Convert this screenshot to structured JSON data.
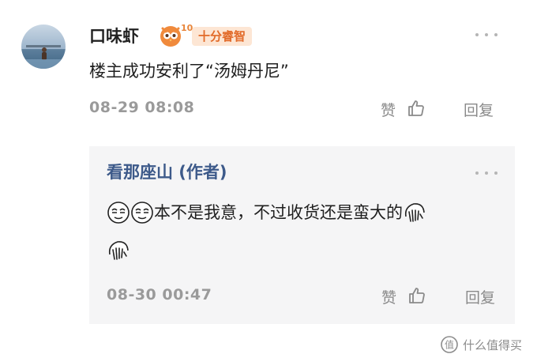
{
  "comment": {
    "username": "口味虾",
    "badge": {
      "level": "10",
      "label": "十分睿智"
    },
    "text": "楼主成功安利了“汤姆丹尼”",
    "timestamp": "08-29 08:08",
    "like_label": "赞",
    "reply_label": "回复"
  },
  "reply": {
    "author": "看那座山 (作者)",
    "text": "本不是我意，不过收货还是蛮大的",
    "timestamp": "08-30 00:47",
    "like_label": "赞",
    "reply_label": "回复"
  },
  "watermark": {
    "text": "什么值得买"
  },
  "colors": {
    "author_link": "#3d5a8a",
    "badge_text": "#e26b2a",
    "badge_bg": "#fde6d4",
    "reply_bg": "#f5f5f6"
  }
}
